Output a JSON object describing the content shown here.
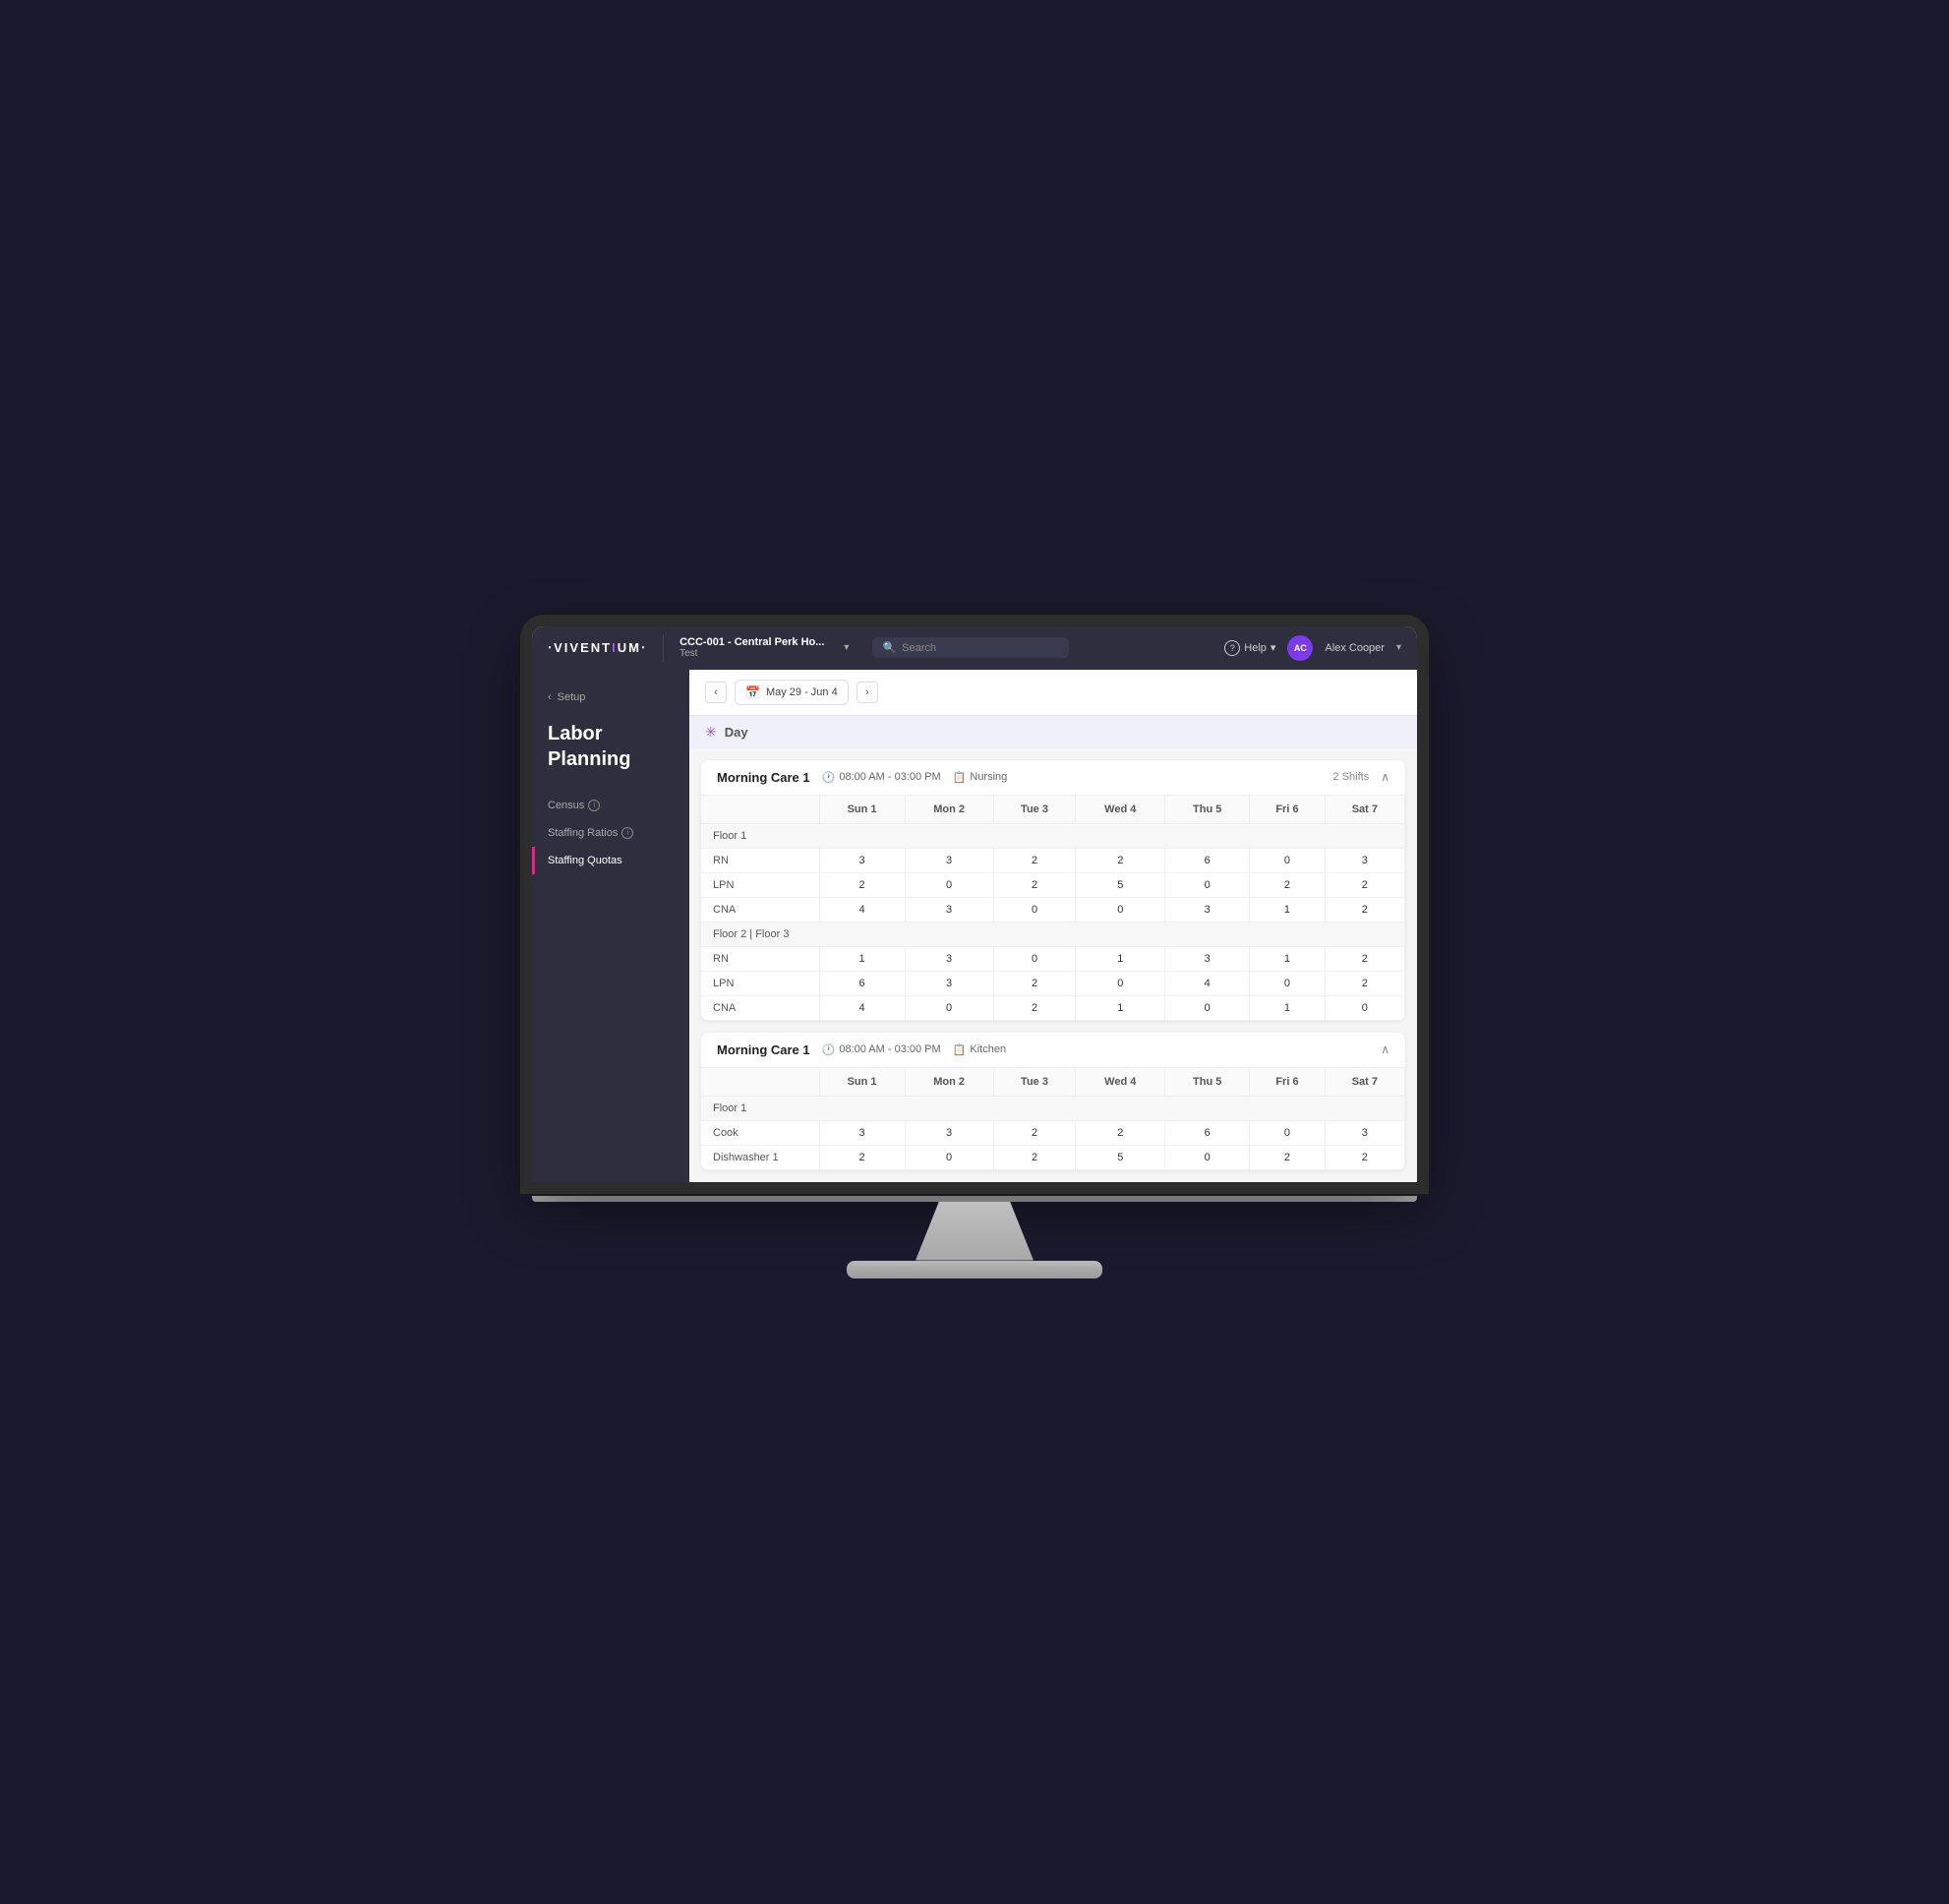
{
  "topBar": {
    "logo": "VIVENTIUM",
    "company": {
      "name": "CCC-001 - Central Perk Ho...",
      "sub": "Test"
    },
    "search": {
      "placeholder": "Search"
    },
    "help": "Help",
    "user": {
      "initials": "AC",
      "name": "Alex Cooper"
    }
  },
  "sidebar": {
    "back": "Setup",
    "pageTitle": "Labor Planning",
    "navItems": [
      {
        "label": "Census",
        "hasInfo": true,
        "active": false
      },
      {
        "label": "Staffing Ratios",
        "hasInfo": true,
        "active": false
      },
      {
        "label": "Staffing Quotas",
        "hasInfo": false,
        "active": true
      }
    ]
  },
  "header": {
    "prevLabel": "‹",
    "nextLabel": "›",
    "dateRange": "May 29 - Jun 4"
  },
  "daySection": {
    "label": "Day"
  },
  "shifts": [
    {
      "name": "Morning Care 1",
      "time": "08:00 AM - 03:00 PM",
      "dept": "Nursing",
      "shiftsCount": "2 Shifts",
      "collapsed": false,
      "columns": [
        "",
        "Sun 1",
        "Mon 2",
        "Tue 3",
        "Wed 4",
        "Thu 5",
        "Fri 6",
        "Sat 7"
      ],
      "floors": [
        {
          "name": "Floor 1",
          "rows": [
            {
              "role": "RN",
              "values": [
                "3",
                "3",
                "2",
                "2",
                "6",
                "0",
                "3"
              ]
            },
            {
              "role": "LPN",
              "values": [
                "2",
                "0",
                "2",
                "5",
                "0",
                "2",
                "2"
              ]
            },
            {
              "role": "CNA",
              "values": [
                "4",
                "3",
                "0",
                "0",
                "3",
                "1",
                "2"
              ]
            }
          ]
        },
        {
          "name": "Floor 2 | Floor 3",
          "rows": [
            {
              "role": "RN",
              "values": [
                "1",
                "3",
                "0",
                "1",
                "3",
                "1",
                "2"
              ]
            },
            {
              "role": "LPN",
              "values": [
                "6",
                "3",
                "2",
                "0",
                "4",
                "0",
                "2"
              ]
            },
            {
              "role": "CNA",
              "values": [
                "4",
                "0",
                "2",
                "1",
                "0",
                "1",
                "0"
              ]
            }
          ]
        }
      ]
    },
    {
      "name": "Morning Care 1",
      "time": "08:00 AM - 03:00 PM",
      "dept": "Kitchen",
      "shiftsCount": "",
      "collapsed": false,
      "columns": [
        "",
        "Sun 1",
        "Mon 2",
        "Tue 3",
        "Wed 4",
        "Thu 5",
        "Fri 6",
        "Sat 7"
      ],
      "floors": [
        {
          "name": "Floor 1",
          "rows": [
            {
              "role": "Cook",
              "values": [
                "3",
                "3",
                "2",
                "2",
                "6",
                "0",
                "3"
              ]
            },
            {
              "role": "Dishwasher 1",
              "values": [
                "2",
                "0",
                "2",
                "5",
                "0",
                "2",
                "2"
              ]
            }
          ]
        }
      ]
    }
  ]
}
